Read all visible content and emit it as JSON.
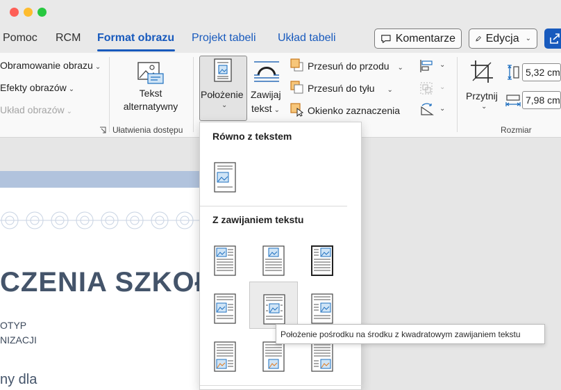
{
  "tabs": [
    {
      "label": "Pomoc",
      "state": "plain"
    },
    {
      "label": "RCM",
      "state": "plain"
    },
    {
      "label": "Format obrazu",
      "state": "active"
    },
    {
      "label": "Projekt tabeli",
      "state": "contextual"
    },
    {
      "label": "Układ tabeli",
      "state": "contextual"
    }
  ],
  "header_buttons": {
    "comments": "Komentarze",
    "editing": "Edycja"
  },
  "ribbon": {
    "picture_styles": {
      "border": "Obramowanie obrazu",
      "effects": "Efekty obrazów",
      "layout": "Układ obrazów"
    },
    "accessibility": {
      "alt_text_line1": "Tekst",
      "alt_text_line2": "alternatywny",
      "group_label": "Ułatwienia dostępu"
    },
    "arrange": {
      "position": "Położenie",
      "wrap_line1": "Zawijaj",
      "wrap_line2": "tekst",
      "bring_forward": "Przesuń do przodu",
      "send_backward": "Przesuń do tyłu",
      "selection_pane": "Okienko zaznaczenia"
    },
    "size": {
      "crop": "Przytnij",
      "height": "5,32 cm",
      "width": "7,98 cm",
      "group_label": "Rozmiar"
    }
  },
  "document": {
    "heading": "CZENIA SZKOŁY",
    "line1": "OTYP",
    "line2": "NIZACJI",
    "subheading": "ny dla"
  },
  "position_menu": {
    "section_inline": "Równo z tekstem",
    "section_wrap": "Z zawijaniem tekstu",
    "hovered_option": "Położenie pośrodku na środku z kwadratowym zawijaniem tekstu"
  },
  "tooltip": "Położenie pośrodku na środku z kwadratowym zawijaniem tekstu",
  "colors": {
    "accent": "#185abd",
    "heading": "#44546a",
    "band": "#b1c3dd"
  }
}
